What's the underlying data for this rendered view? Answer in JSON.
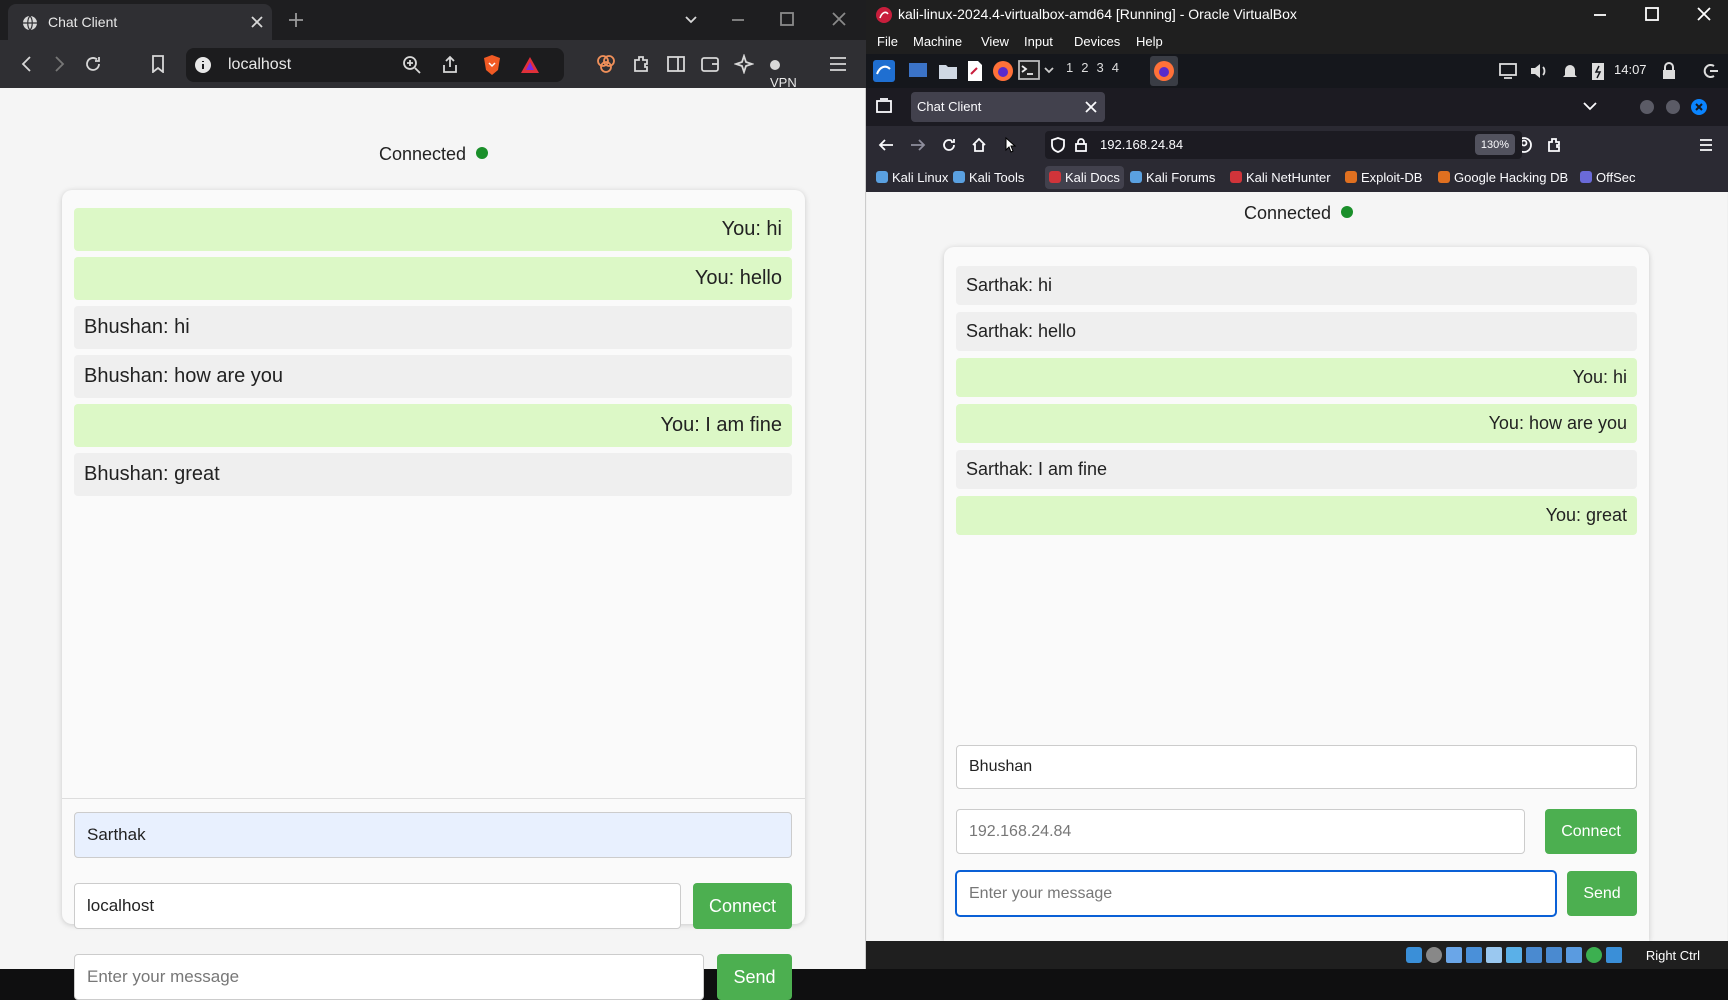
{
  "left_browser": {
    "tab_title": "Chat Client",
    "url": "localhost",
    "vpn_label": "VPN",
    "status_text": "Connected",
    "messages": [
      {
        "text": "You: hi",
        "side": "me"
      },
      {
        "text": "You: hello",
        "side": "me"
      },
      {
        "text": "Bhushan: hi",
        "side": "other"
      },
      {
        "text": "Bhushan: how are you",
        "side": "other"
      },
      {
        "text": "You: I am fine",
        "side": "me"
      },
      {
        "text": "Bhushan: great",
        "side": "other"
      }
    ],
    "username_value": "Sarthak",
    "server_value": "localhost",
    "connect_label": "Connect",
    "message_placeholder": "Enter your message",
    "send_label": "Send"
  },
  "vbox": {
    "window_title": "kali-linux-2024.4-virtualbox-amd64 [Running] - Oracle VirtualBox",
    "menu": [
      "File",
      "Machine",
      "View",
      "Input",
      "Devices",
      "Help"
    ],
    "workspaces": [
      "1",
      "2",
      "3",
      "4"
    ],
    "clock": "14:07",
    "host_key": "Right Ctrl"
  },
  "right_browser": {
    "tab_title": "Chat Client",
    "url": "192.168.24.84",
    "zoom": "130%",
    "bookmarks": [
      {
        "label": "Kali Linux",
        "color": "#5aa0e0"
      },
      {
        "label": "Kali Tools",
        "color": "#5aa0e0"
      },
      {
        "label": "Kali Docs",
        "color": "#d0343a"
      },
      {
        "label": "Kali Forums",
        "color": "#5aa0e0"
      },
      {
        "label": "Kali NetHunter",
        "color": "#d0343a"
      },
      {
        "label": "Exploit-DB",
        "color": "#e07020"
      },
      {
        "label": "Google Hacking DB",
        "color": "#e07020"
      },
      {
        "label": "OffSec",
        "color": "#6a6ad8"
      }
    ],
    "status_text": "Connected",
    "messages": [
      {
        "text": "Sarthak: hi",
        "side": "other"
      },
      {
        "text": "Sarthak: hello",
        "side": "other"
      },
      {
        "text": "You: hi",
        "side": "me"
      },
      {
        "text": "You: how are you",
        "side": "me"
      },
      {
        "text": "Sarthak: I am fine",
        "side": "other"
      },
      {
        "text": "You: great",
        "side": "me"
      }
    ],
    "username_value": "Bhushan",
    "server_value": "192.168.24.84",
    "connect_label": "Connect",
    "message_placeholder": "Enter your message",
    "send_label": "Send"
  },
  "colors": {
    "my_message_bg": "#dcf8c6",
    "other_message_bg": "#efefef",
    "button_green": "#4caf50",
    "status_dot": "#1a8f2a"
  }
}
